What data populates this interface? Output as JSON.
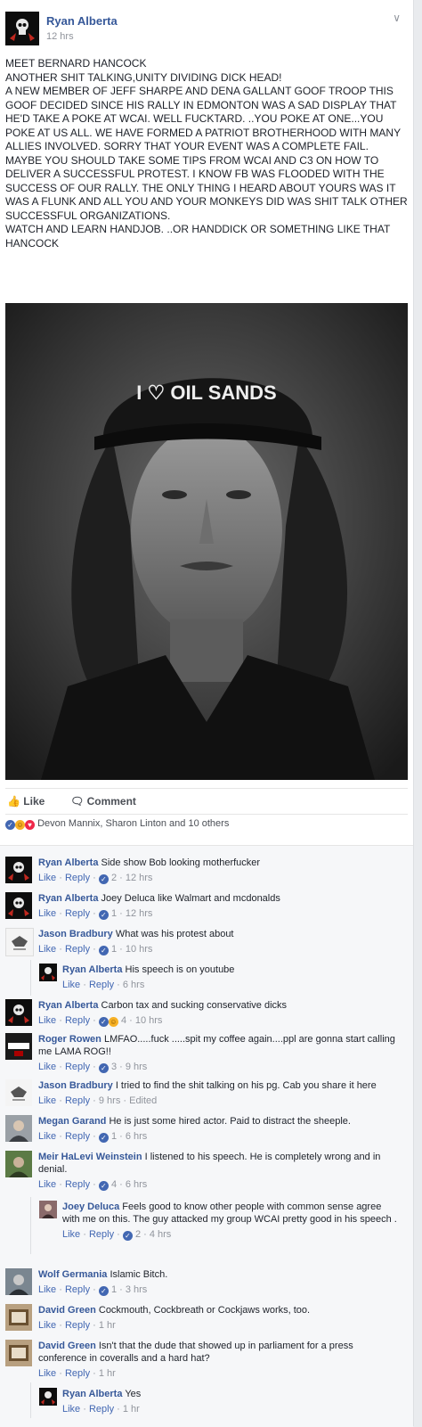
{
  "post": {
    "author": "Ryan Alberta",
    "time": "12 hrs",
    "text": [
      "MEET BERNARD HANCOCK",
      "ANOTHER SHIT TALKING,UNITY DIVIDING DICK HEAD!",
      "A NEW MEMBER OF JEFF SHARPE AND DENA GALLANT GOOF TROOP THIS GOOF DECIDED SINCE HIS RALLY IN EDMONTON WAS A SAD DISPLAY THAT HE'D TAKE A POKE AT WCAI. WELL FUCKTARD. ..YOU POKE AT ONE...YOU POKE AT US ALL. WE HAVE FORMED A PATRIOT BROTHERHOOD WITH MANY ALLIES INVOLVED. SORRY THAT YOUR EVENT WAS A COMPLETE FAIL. MAYBE YOU SHOULD TAKE SOME TIPS FROM WCAI AND C3 ON HOW TO DELIVER A SUCCESSFUL PROTEST. I KNOW FB WAS FLOODED WITH THE SUCCESS OF OUR RALLY. THE ONLY THING I HEARD ABOUT YOURS WAS IT WAS A FLUNK AND ALL YOU AND YOUR MONKEYS DID WAS SHIT TALK OTHER SUCCESSFUL ORGANIZATIONS.",
      "WATCH AND LEARN HANDJOB. ..OR HANDDICK OR SOMETHING LIKE THAT HANCOCK"
    ],
    "photo_cap": "I ♡ OIL SANDS",
    "like_label": "Like",
    "comment_label": "Comment",
    "reactions_text": "Devon Mannix, Sharon Linton and 10 others"
  },
  "comments": [
    {
      "name": "Ryan Alberta",
      "text": "Side show Bob looking motherfucker",
      "likes": "2",
      "time": "12 hrs"
    },
    {
      "name": "Ryan Alberta",
      "text": "Joey Deluca like Walmart and mcdonalds",
      "likes": "1",
      "time": "12 hrs"
    },
    {
      "name": "Jason Bradbury",
      "text": "What was his protest about",
      "likes": "1",
      "time": "10 hrs"
    },
    {
      "name": "Ryan Alberta",
      "text": "His speech is on youtube",
      "time": "6 hrs"
    },
    {
      "name": "Ryan Alberta",
      "text": "Carbon tax and sucking conservative dicks",
      "likes": "4",
      "time": "10 hrs"
    },
    {
      "name": "Roger Rowen",
      "text": "LMFAO.....fuck .....spit my coffee again....ppl are gonna start calling me LAMA ROG!!",
      "likes": "3",
      "time": "9 hrs"
    },
    {
      "name": "Jason Bradbury",
      "text": "I tried to find the shit talking on his pg. Cab you share it here",
      "time": "9 hrs · Edited"
    },
    {
      "name": "Megan Garand",
      "text": "He is just some hired actor. Paid to distract the sheeple.",
      "likes": "1",
      "time": "6 hrs"
    },
    {
      "name": "Meir HaLevi Weinstein",
      "text": "I listened to his speech. He is completely wrong and in denial.",
      "likes": "4",
      "time": "6 hrs"
    },
    {
      "name": "Joey Deluca",
      "text": "Feels good to know other people with common sense agree with me on this. The guy attacked my group WCAI pretty good in his speech .",
      "likes": "2",
      "time": "4 hrs"
    },
    {
      "name": "Wolf Germania",
      "text": "Islamic Bitch.",
      "likes": "1",
      "time": "3 hrs"
    },
    {
      "name": "David Green",
      "text": "Cockmouth, Cockbreath or Cockjaws works, too.",
      "time": "1 hr"
    },
    {
      "name": "David Green",
      "text": "Isn't that the dude that showed up in parliament for a press conference in coveralls and a hard hat?",
      "time": "1 hr"
    },
    {
      "name": "Ryan Alberta",
      "text": "Yes",
      "time": "1 hr"
    }
  ],
  "ui": {
    "like": "Like",
    "reply": "Reply",
    "sep": " · "
  },
  "colors": {
    "link": "#365899",
    "meta": "#90949c",
    "accent": "#4267b2"
  }
}
